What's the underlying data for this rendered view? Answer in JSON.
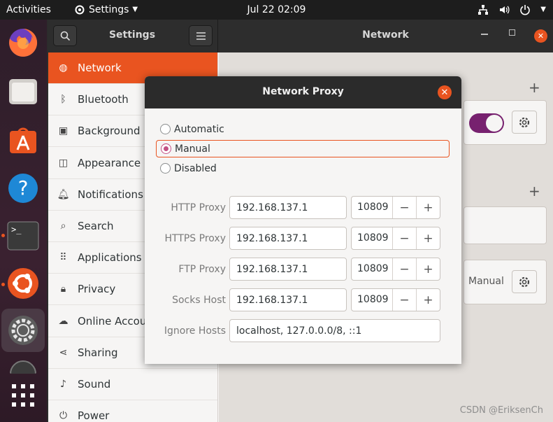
{
  "topbar": {
    "activities": "Activities",
    "app_menu": "Settings",
    "clock": "Jul 22  02:09"
  },
  "settings": {
    "sidebar_title": "Settings",
    "main_title": "Network",
    "sidebar_items": [
      {
        "label": "Network",
        "icon": "network-icon",
        "active": true
      },
      {
        "label": "Bluetooth",
        "icon": "bluetooth-icon"
      },
      {
        "label": "Background",
        "icon": "background-icon"
      },
      {
        "label": "Appearance",
        "icon": "appearance-icon"
      },
      {
        "label": "Notifications",
        "icon": "bell-icon"
      },
      {
        "label": "Search",
        "icon": "search-icon"
      },
      {
        "label": "Applications",
        "icon": "grid-icon"
      },
      {
        "label": "Privacy",
        "icon": "lock-icon"
      },
      {
        "label": "Online Accounts",
        "icon": "cloud-icon"
      },
      {
        "label": "Sharing",
        "icon": "share-icon"
      },
      {
        "label": "Sound",
        "icon": "music-icon"
      },
      {
        "label": "Power",
        "icon": "power-icon"
      }
    ],
    "proxy_mode_label": "Manual"
  },
  "dialog": {
    "title": "Network Proxy",
    "modes": [
      {
        "label": "Automatic",
        "checked": false
      },
      {
        "label": "Manual",
        "checked": true
      },
      {
        "label": "Disabled",
        "checked": false
      }
    ],
    "proxies": [
      {
        "label": "HTTP Proxy",
        "host": "192.168.137.1",
        "port": "10809"
      },
      {
        "label": "HTTPS Proxy",
        "host": "192.168.137.1",
        "port": "10809"
      },
      {
        "label": "FTP Proxy",
        "host": "192.168.137.1",
        "port": "10809"
      },
      {
        "label": "Socks Host",
        "host": "192.168.137.1",
        "port": "10809"
      }
    ],
    "ignore_hosts_label": "Ignore Hosts",
    "ignore_hosts_value": "localhost, 127.0.0.0/8, ::1"
  },
  "watermark": "CSDN @EriksenCh",
  "colors": {
    "accent": "#e95420",
    "radio": "#c35084",
    "toggle": "#77216f"
  }
}
